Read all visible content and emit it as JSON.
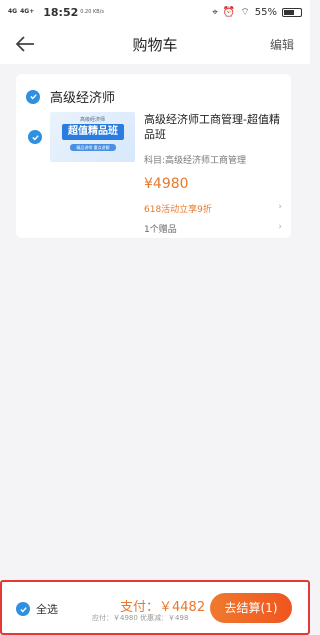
{
  "status_bar": {
    "signal_1": "4G",
    "signal_2": "4G+",
    "time": "18:52",
    "speed": "0.20 KB/s",
    "battery": "55%"
  },
  "nav": {
    "title": "购物车",
    "edit_label": "编辑"
  },
  "cart": {
    "shop_name": "高级经济师",
    "item": {
      "thumb_small_text": "高级经济师",
      "thumb_big_text": "超值精品班",
      "thumb_tag_text": "精品讲师 重点讲解",
      "name": "高级经济师工商管理-超值精品班",
      "subject": "科目:高级经济师工商管理",
      "price": "¥4980",
      "promo": "618活动立享9折",
      "gift": "1个赠品"
    }
  },
  "bottom": {
    "select_all": "全选",
    "pay_label": "支付：￥4482",
    "pay_detail": "应付：￥4980 优惠减：￥498",
    "checkout_label": "去结算(1)"
  },
  "colors": {
    "accent": "#e9782b",
    "check": "#2f8fe0",
    "highlight": "#e53935"
  }
}
